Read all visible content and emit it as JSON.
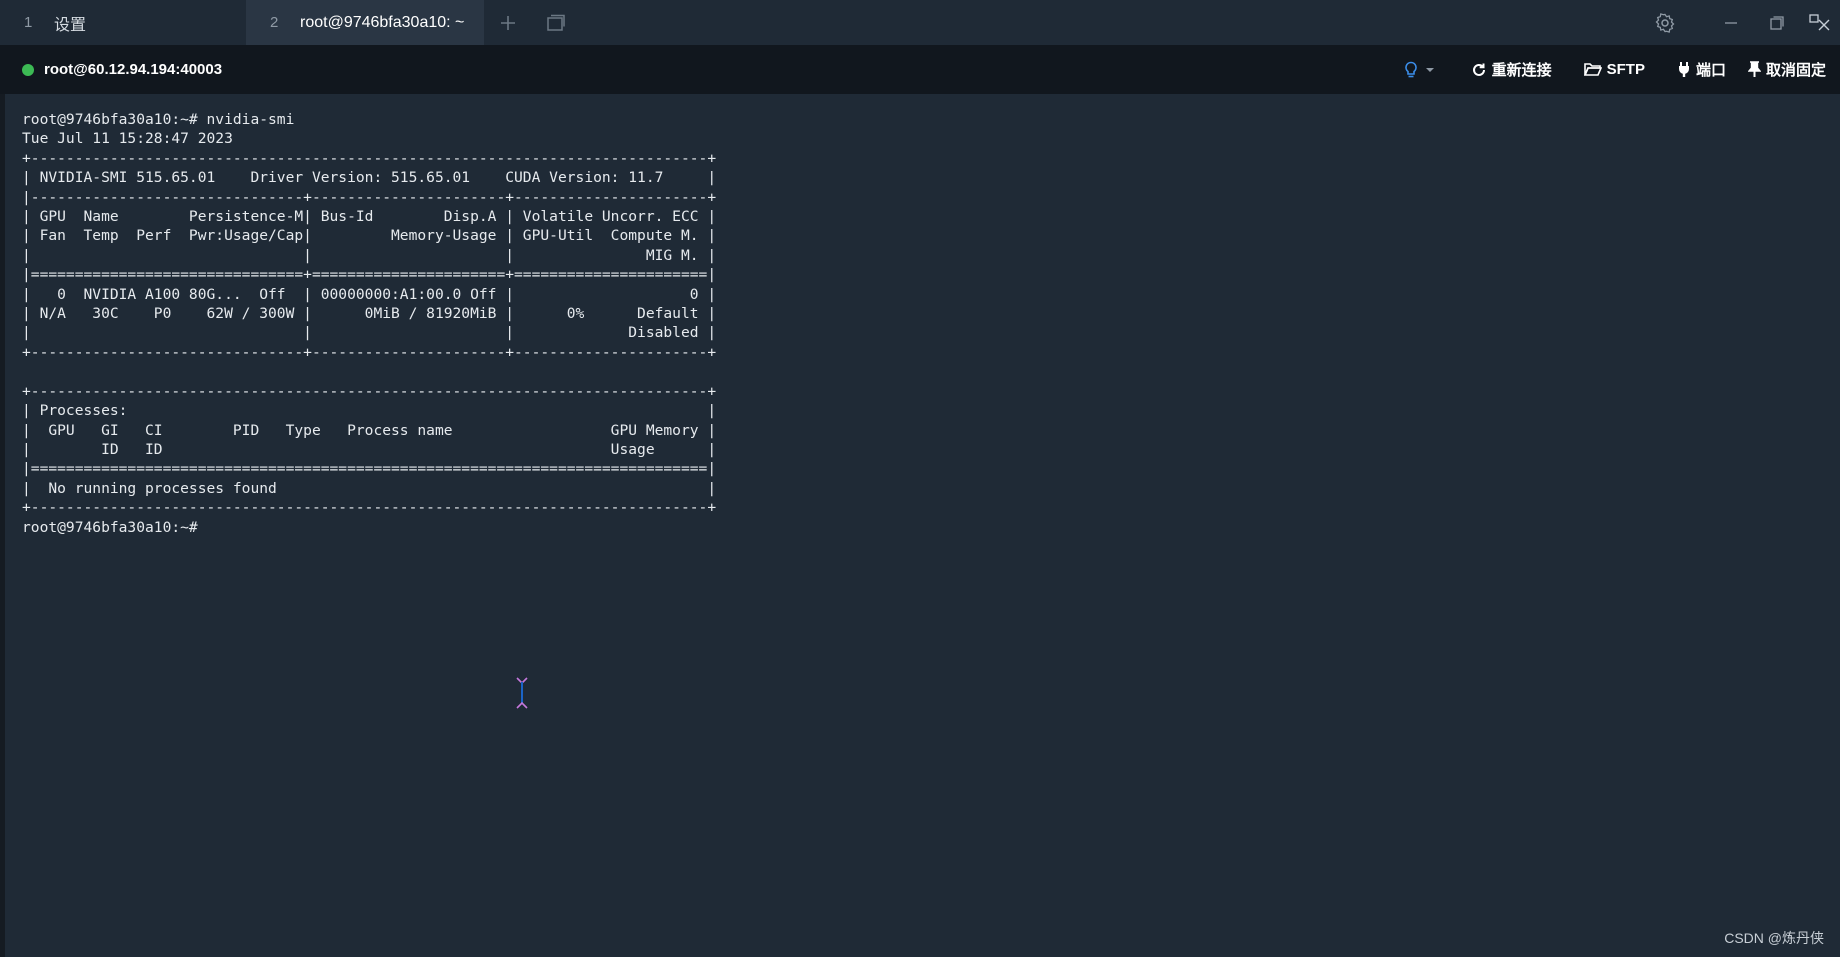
{
  "tabs": [
    {
      "number": "1",
      "label": "设置"
    },
    {
      "number": "2",
      "label": "root@9746bfa30a10: ~"
    }
  ],
  "icons": {
    "add_tab": "plus-icon",
    "new_window": "window-icon",
    "settings": "gear-icon",
    "minimize": "minimize-icon",
    "restore": "restore-icon",
    "close": "close-icon",
    "bulb": "bulb-icon",
    "reconnect": "reconnect-icon",
    "sftp": "folder-icon",
    "port": "plug-icon",
    "unpin": "pin-icon"
  },
  "session": {
    "host": "root@60.12.94.194:40003",
    "status_color": "#3cba54"
  },
  "toolbar": {
    "reconnect_label": "重新连接",
    "sftp_label": "SFTP",
    "port_label": "端口",
    "unpin_label": "取消固定"
  },
  "terminal": {
    "lines": [
      "root@9746bfa30a10:~# nvidia-smi",
      "Tue Jul 11 15:28:47 2023",
      "+-----------------------------------------------------------------------------+",
      "| NVIDIA-SMI 515.65.01    Driver Version: 515.65.01    CUDA Version: 11.7     |",
      "|-------------------------------+----------------------+----------------------+",
      "| GPU  Name        Persistence-M| Bus-Id        Disp.A | Volatile Uncorr. ECC |",
      "| Fan  Temp  Perf  Pwr:Usage/Cap|         Memory-Usage | GPU-Util  Compute M. |",
      "|                               |                      |               MIG M. |",
      "|===============================+======================+======================|",
      "|   0  NVIDIA A100 80G...  Off  | 00000000:A1:00.0 Off |                    0 |",
      "| N/A   30C    P0    62W / 300W |      0MiB / 81920MiB |      0%      Default |",
      "|                               |                      |             Disabled |",
      "+-------------------------------+----------------------+----------------------+",
      "",
      "+-----------------------------------------------------------------------------+",
      "| Processes:                                                                  |",
      "|  GPU   GI   CI        PID   Type   Process name                  GPU Memory |",
      "|        ID   ID                                                   Usage      |",
      "|=============================================================================|",
      "|  No running processes found                                                 |",
      "+-----------------------------------------------------------------------------+",
      "root@9746bfa30a10:~#"
    ]
  },
  "watermark": "CSDN @炼丹侠"
}
